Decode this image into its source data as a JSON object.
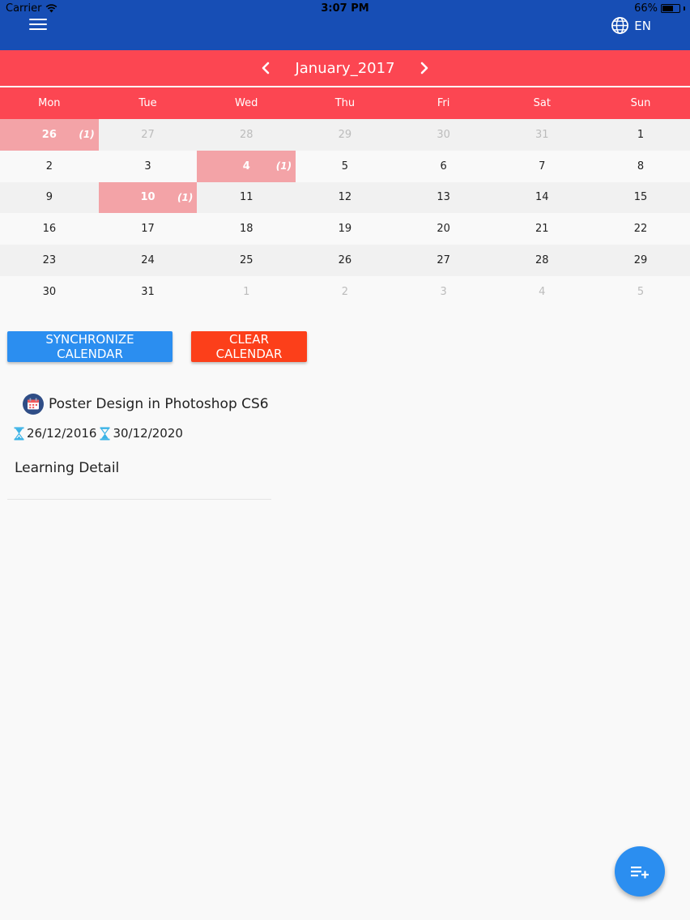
{
  "status_bar": {
    "carrier": "Carrier",
    "time": "3:07 PM",
    "battery": "66%",
    "battery_level": 0.66
  },
  "app_bar": {
    "language": "EN"
  },
  "calendar": {
    "month_label": "January_2017",
    "weekdays": [
      "Mon",
      "Tue",
      "Wed",
      "Thu",
      "Fri",
      "Sat",
      "Sun"
    ],
    "weeks": [
      [
        {
          "day": "26",
          "muted": false,
          "count": "(1)"
        },
        {
          "day": "27",
          "muted": true
        },
        {
          "day": "28",
          "muted": true
        },
        {
          "day": "29",
          "muted": true
        },
        {
          "day": "30",
          "muted": true
        },
        {
          "day": "31",
          "muted": true
        },
        {
          "day": "1",
          "muted": false
        }
      ],
      [
        {
          "day": "2"
        },
        {
          "day": "3"
        },
        {
          "day": "4",
          "count": "(1)"
        },
        {
          "day": "5"
        },
        {
          "day": "6"
        },
        {
          "day": "7"
        },
        {
          "day": "8"
        }
      ],
      [
        {
          "day": "9"
        },
        {
          "day": "10",
          "count": "(1)"
        },
        {
          "day": "11"
        },
        {
          "day": "12"
        },
        {
          "day": "13"
        },
        {
          "day": "14"
        },
        {
          "day": "15"
        }
      ],
      [
        {
          "day": "16"
        },
        {
          "day": "17"
        },
        {
          "day": "18"
        },
        {
          "day": "19"
        },
        {
          "day": "20"
        },
        {
          "day": "21"
        },
        {
          "day": "22"
        }
      ],
      [
        {
          "day": "23"
        },
        {
          "day": "24"
        },
        {
          "day": "25"
        },
        {
          "day": "26"
        },
        {
          "day": "27"
        },
        {
          "day": "28"
        },
        {
          "day": "29"
        }
      ],
      [
        {
          "day": "30"
        },
        {
          "day": "31"
        },
        {
          "day": "1",
          "muted": true
        },
        {
          "day": "2",
          "muted": true
        },
        {
          "day": "3",
          "muted": true
        },
        {
          "day": "4",
          "muted": true
        },
        {
          "day": "5",
          "muted": true
        }
      ]
    ]
  },
  "actions": {
    "sync_label": "SYNCHRONIZE CALENDAR",
    "clear_label": "CLEAR CALENDAR"
  },
  "event": {
    "title": "Poster Design in Photoshop CS6",
    "start_date": "26/12/2016",
    "end_date": "30/12/2020",
    "detail_link": "Learning Detail"
  },
  "colors": {
    "app_bar": "#174eb5",
    "calendar_header": "#fc4652",
    "event_day": "#f3a3a7",
    "sync_button": "#2b8ef0",
    "clear_button": "#fc3f1a",
    "fab": "#2b8ef0"
  },
  "icons": {
    "menu": "hamburger-menu-icon",
    "language": "globe-icon",
    "prev": "chevron-left-icon",
    "next": "chevron-right-icon",
    "event": "calendar-icon",
    "start": "hourglass-icon",
    "end": "hourglass-icon",
    "fab": "playlist-add-icon"
  }
}
